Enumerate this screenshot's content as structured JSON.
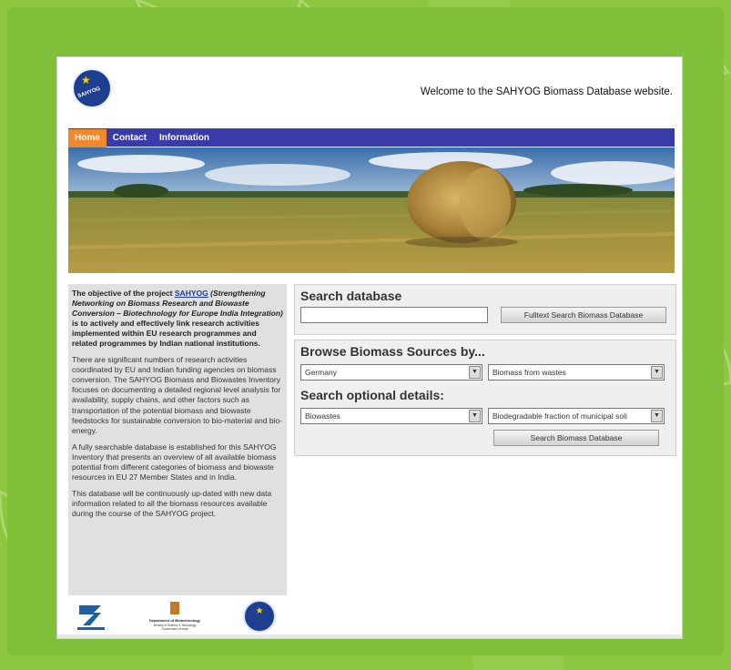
{
  "header": {
    "welcome": "Welcome to the SAHYOG Biomass Database website."
  },
  "nav": {
    "items": [
      "Home",
      "Contact",
      "Information"
    ]
  },
  "sidebar": {
    "intro_pre": "The objective of the project ",
    "intro_link": "SAHYOG",
    "intro_italic": "(Strengthening Networking on Biomass Research and Biowaste Conversion – Biotechnology for Europe India Integration)",
    "intro_post": " is to actively and effectively link research activities implemented within EU research programmes and related programmes by Indian national institutions.",
    "p2": "There are significant numbers of research activities coordinated by EU and Indian funding agencies on biomass conversion. The SAHYOG Biomass and Biowastes Inventory focuses on documenting a detailed regional level analysis for availability, supply chains, and other factors such as transportation of the potential biomass and biowaste feedstocks for sustainable conversion to bio-material and bio-energy.",
    "p3": "A fully searchable database is established for this SAHYOG Inventory that presents an overview of all available biomass potential from different categories of biomass and biowaste resources in EU 27 Member States and in India.",
    "p4": "This database will be continuously up-dated with new data information related to all the biomass resources available during the course of the SAHYOG project."
  },
  "search": {
    "title": "Search database",
    "input_value": "",
    "button": "Fulltext Search Biomass Database"
  },
  "browse": {
    "title": "Browse Biomass Sources by...",
    "country": "Germany",
    "source": "Biomass from wastes",
    "optional_title": "Search optional details:",
    "category": "Biowastes",
    "subcategory": "Biodegradable fraction of municipal soli",
    "button": "Search Biomass Database"
  },
  "logos": {
    "dbt_title": "Department of Biotechnology",
    "dbt_sub1": "Ministry of Science & Technology",
    "dbt_sub2": "Government of India"
  },
  "colors": {
    "nav": "#3a3aa8",
    "nav_active": "#f0892a",
    "background": "#8dc63f"
  }
}
